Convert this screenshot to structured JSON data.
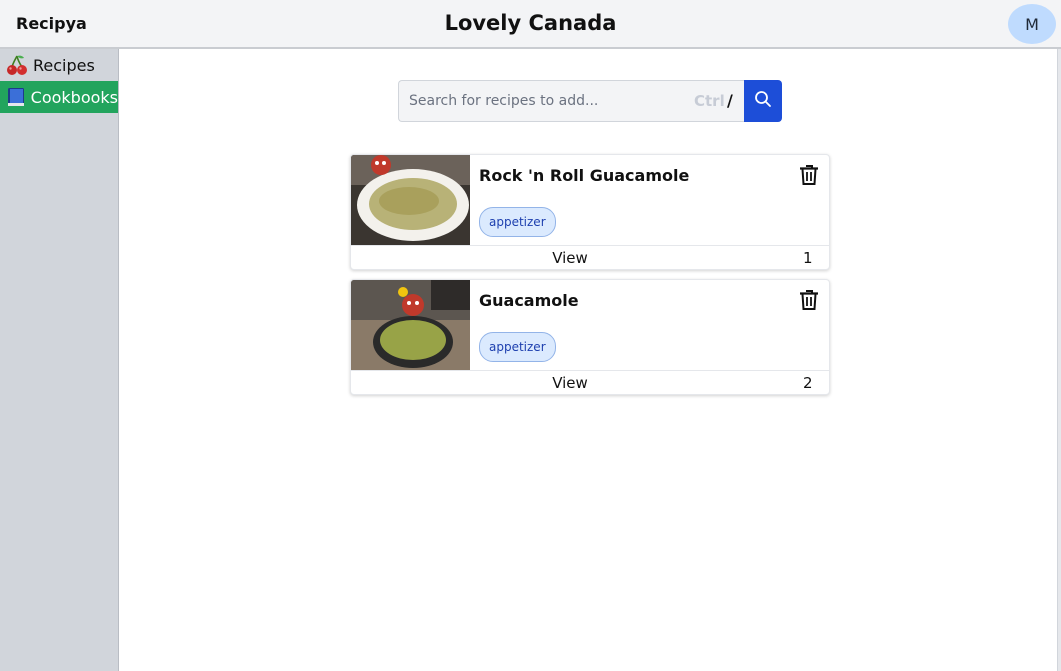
{
  "app": {
    "brand": "Recipya",
    "page_title": "Lovely Canada",
    "avatar_initial": "M"
  },
  "sidebar": {
    "items": [
      {
        "label": "Recipes",
        "icon": "cherries-icon",
        "active": false
      },
      {
        "label": "Cookbooks",
        "icon": "book-icon",
        "active": true
      }
    ]
  },
  "search": {
    "placeholder": "Search for recipes to add...",
    "value": "",
    "shortcut_ctrl": "Ctrl",
    "shortcut_key": "/"
  },
  "recipes": [
    {
      "name": "Rock 'n Roll Guacamole",
      "tag": "appetizer",
      "view_label": "View",
      "position": "1"
    },
    {
      "name": "Guacamole",
      "tag": "appetizer",
      "view_label": "View",
      "position": "2"
    }
  ],
  "colors": {
    "accent": "#1d4ed8",
    "active_nav": "#22a45d",
    "tag_bg": "#dbeafe"
  }
}
